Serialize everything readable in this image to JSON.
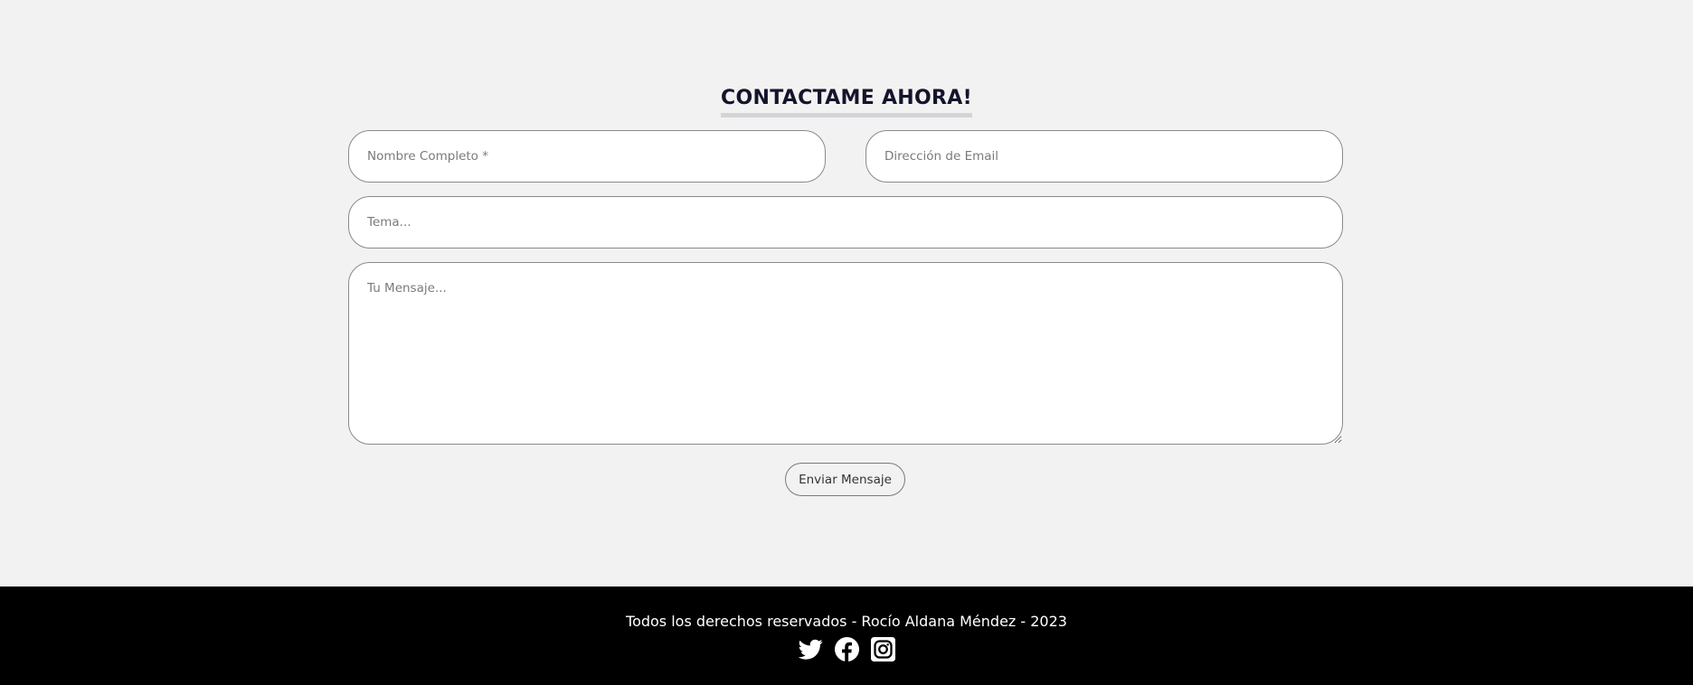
{
  "contact": {
    "title": "CONTACTAME AHORA!",
    "fields": {
      "name_placeholder": "Nombre Completo *",
      "email_placeholder": "Dirección de Email",
      "subject_placeholder": "Tema...",
      "message_placeholder": "Tu Mensaje..."
    },
    "submit_label": "Enviar Mensaje"
  },
  "footer": {
    "copyright": "Todos los derechos reservados - Rocío Aldana Méndez - 2023",
    "social": [
      {
        "name": "twitter-icon"
      },
      {
        "name": "facebook-icon"
      },
      {
        "name": "instagram-icon"
      }
    ]
  },
  "colors": {
    "background": "#f2f2f2",
    "title": "#14142b",
    "footer_bg": "#000000",
    "footer_text": "#ffffff"
  }
}
